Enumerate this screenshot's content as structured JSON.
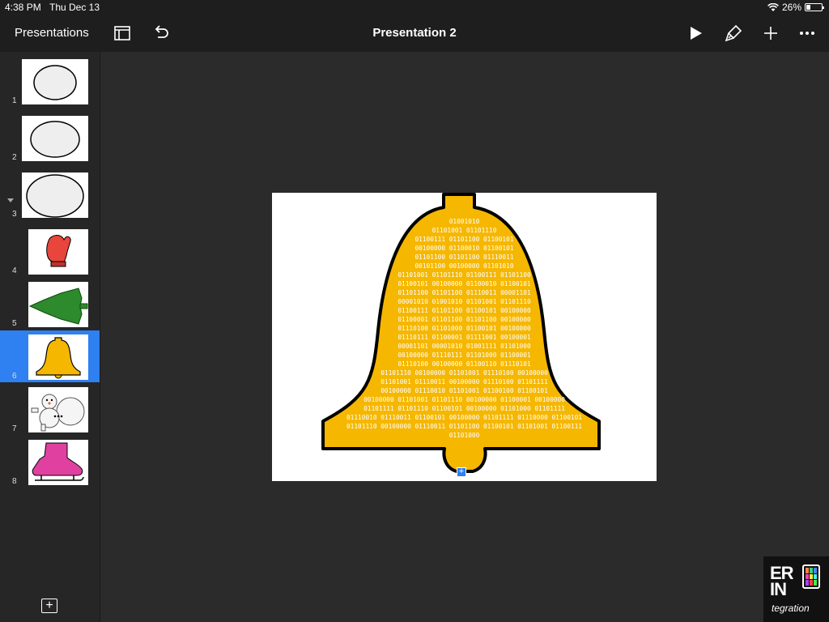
{
  "status": {
    "time": "4:38 PM",
    "date": "Thu Dec 13",
    "battery": "26%",
    "battery_level": 0.26
  },
  "toolbar": {
    "back_label": "Presentations",
    "title": "Presentation 2"
  },
  "slides": [
    {
      "number": "1"
    },
    {
      "number": "2"
    },
    {
      "number": "3"
    },
    {
      "number": "4"
    },
    {
      "number": "5"
    },
    {
      "number": "6"
    },
    {
      "number": "7"
    },
    {
      "number": "8"
    }
  ],
  "selected_slide": 6,
  "canvas": {
    "binary_lines": [
      "01001010",
      "01101001 01101110",
      "01100111 01101100 01100101",
      "00100000 01100010 01100101",
      "01101100 01101100 01110011",
      "00101100 00100000 01101010",
      "01101001 01101110 01100111 01101100",
      "01100101 00100000 01100010 01100101",
      "01101100 01101100 01110011 00001101",
      "00001010 01001010 01101001 01101110",
      "01100111 01101100 01100101 00100000",
      "01100001 01101100 01101100 00100000",
      "01110100 01101000 01100101 00100000",
      "01110111 01100001 01111001 00100001",
      "00001101 00001010 01001111 01101000",
      "00100000 01110111 01101000 01100001",
      "01110100 00100000 01100110 01110101",
      "01101110 00100000 01101001 01110100 00100000",
      "01101001 01110011 00100000 01110100 01101111",
      "00100000 01110010 01101001 01100100 01100101",
      "00100000 01101001 01101110 00100000 01100001 00100000",
      "01101111 01101110 01100101 00100000 01101000 01101111",
      "01110010 01110011 01100101 00100000 01101111 01110000 01100101",
      "01101110 00100000 01110011 01101100 01100101 01101001 01100111",
      "01101000"
    ]
  },
  "colors": {
    "bell": "#f5b700",
    "selection": "#2f80f0",
    "toolbar": "#1e1e1e",
    "canvas_bg": "#2b2b2b"
  },
  "logo": {
    "line1": "ER",
    "line2": "IN",
    "line3": "tegration"
  }
}
